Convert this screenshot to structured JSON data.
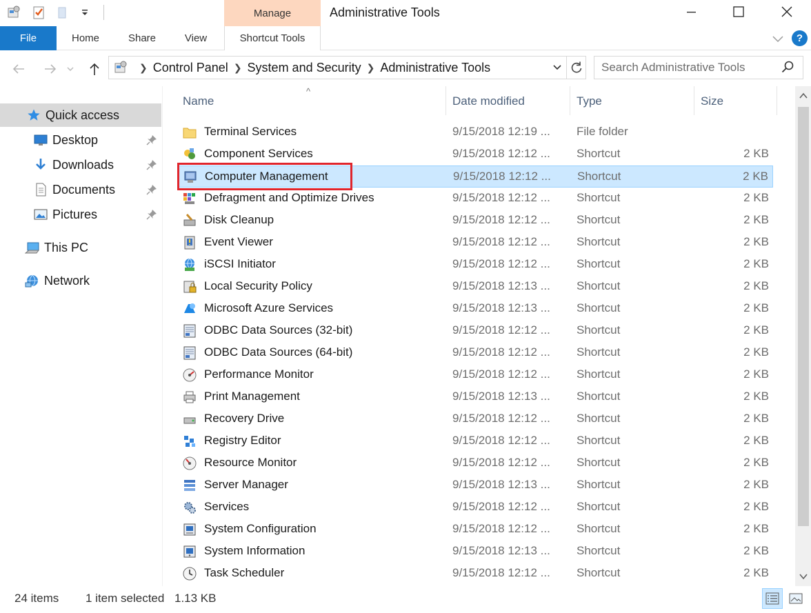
{
  "window": {
    "title": "Administrative Tools",
    "context_group": "Manage"
  },
  "ribbon": {
    "file": "File",
    "tabs": [
      "Home",
      "Share",
      "View"
    ],
    "context_tab": "Shortcut Tools"
  },
  "address": {
    "crumbs": [
      "Control Panel",
      "System and Security",
      "Administrative Tools"
    ],
    "search_placeholder": "Search Administrative Tools"
  },
  "nav": {
    "quick_access": "Quick access",
    "pinned": [
      {
        "label": "Desktop",
        "icon": "desktop-icon"
      },
      {
        "label": "Downloads",
        "icon": "downloads-icon"
      },
      {
        "label": "Documents",
        "icon": "documents-icon"
      },
      {
        "label": "Pictures",
        "icon": "pictures-icon"
      }
    ],
    "this_pc": "This PC",
    "network": "Network"
  },
  "columns": {
    "name": "Name",
    "date": "Date modified",
    "type": "Type",
    "size": "Size"
  },
  "files": [
    {
      "name": "Terminal Services",
      "date": "9/15/2018 12:19 ...",
      "type": "File folder",
      "size": "",
      "icon": "folder-icon"
    },
    {
      "name": "Component Services",
      "date": "9/15/2018 12:12 ...",
      "type": "Shortcut",
      "size": "2 KB",
      "icon": "component-services-icon"
    },
    {
      "name": "Computer Management",
      "date": "9/15/2018 12:12 ...",
      "type": "Shortcut",
      "size": "2 KB",
      "icon": "computer-management-icon",
      "selected": true
    },
    {
      "name": "Defragment and Optimize Drives",
      "date": "9/15/2018 12:12 ...",
      "type": "Shortcut",
      "size": "2 KB",
      "icon": "defragment-icon"
    },
    {
      "name": "Disk Cleanup",
      "date": "9/15/2018 12:12 ...",
      "type": "Shortcut",
      "size": "2 KB",
      "icon": "disk-cleanup-icon"
    },
    {
      "name": "Event Viewer",
      "date": "9/15/2018 12:12 ...",
      "type": "Shortcut",
      "size": "2 KB",
      "icon": "event-viewer-icon"
    },
    {
      "name": "iSCSI Initiator",
      "date": "9/15/2018 12:12 ...",
      "type": "Shortcut",
      "size": "2 KB",
      "icon": "iscsi-icon"
    },
    {
      "name": "Local Security Policy",
      "date": "9/15/2018 12:13 ...",
      "type": "Shortcut",
      "size": "2 KB",
      "icon": "security-policy-icon"
    },
    {
      "name": "Microsoft Azure Services",
      "date": "9/15/2018 12:13 ...",
      "type": "Shortcut",
      "size": "2 KB",
      "icon": "azure-icon"
    },
    {
      "name": "ODBC Data Sources (32-bit)",
      "date": "9/15/2018 12:12 ...",
      "type": "Shortcut",
      "size": "2 KB",
      "icon": "odbc-icon"
    },
    {
      "name": "ODBC Data Sources (64-bit)",
      "date": "9/15/2018 12:12 ...",
      "type": "Shortcut",
      "size": "2 KB",
      "icon": "odbc-icon"
    },
    {
      "name": "Performance Monitor",
      "date": "9/15/2018 12:12 ...",
      "type": "Shortcut",
      "size": "2 KB",
      "icon": "performance-monitor-icon"
    },
    {
      "name": "Print Management",
      "date": "9/15/2018 12:13 ...",
      "type": "Shortcut",
      "size": "2 KB",
      "icon": "print-management-icon"
    },
    {
      "name": "Recovery Drive",
      "date": "9/15/2018 12:12 ...",
      "type": "Shortcut",
      "size": "2 KB",
      "icon": "recovery-drive-icon"
    },
    {
      "name": "Registry Editor",
      "date": "9/15/2018 12:12 ...",
      "type": "Shortcut",
      "size": "2 KB",
      "icon": "registry-editor-icon"
    },
    {
      "name": "Resource Monitor",
      "date": "9/15/2018 12:12 ...",
      "type": "Shortcut",
      "size": "2 KB",
      "icon": "resource-monitor-icon"
    },
    {
      "name": "Server Manager",
      "date": "9/15/2018 12:13 ...",
      "type": "Shortcut",
      "size": "2 KB",
      "icon": "server-manager-icon"
    },
    {
      "name": "Services",
      "date": "9/15/2018 12:12 ...",
      "type": "Shortcut",
      "size": "2 KB",
      "icon": "services-icon"
    },
    {
      "name": "System Configuration",
      "date": "9/15/2018 12:12 ...",
      "type": "Shortcut",
      "size": "2 KB",
      "icon": "system-configuration-icon"
    },
    {
      "name": "System Information",
      "date": "9/15/2018 12:13 ...",
      "type": "Shortcut",
      "size": "2 KB",
      "icon": "system-information-icon"
    },
    {
      "name": "Task Scheduler",
      "date": "9/15/2018 12:12 ...",
      "type": "Shortcut",
      "size": "2 KB",
      "icon": "task-scheduler-icon"
    }
  ],
  "status": {
    "items": "24 items",
    "selected": "1 item selected",
    "size": "1.13 KB"
  },
  "colors": {
    "accent": "#1979ca",
    "manage_tab": "#fdd7bf",
    "selection": "#cce8ff",
    "highlight_box": "#e0252c"
  }
}
